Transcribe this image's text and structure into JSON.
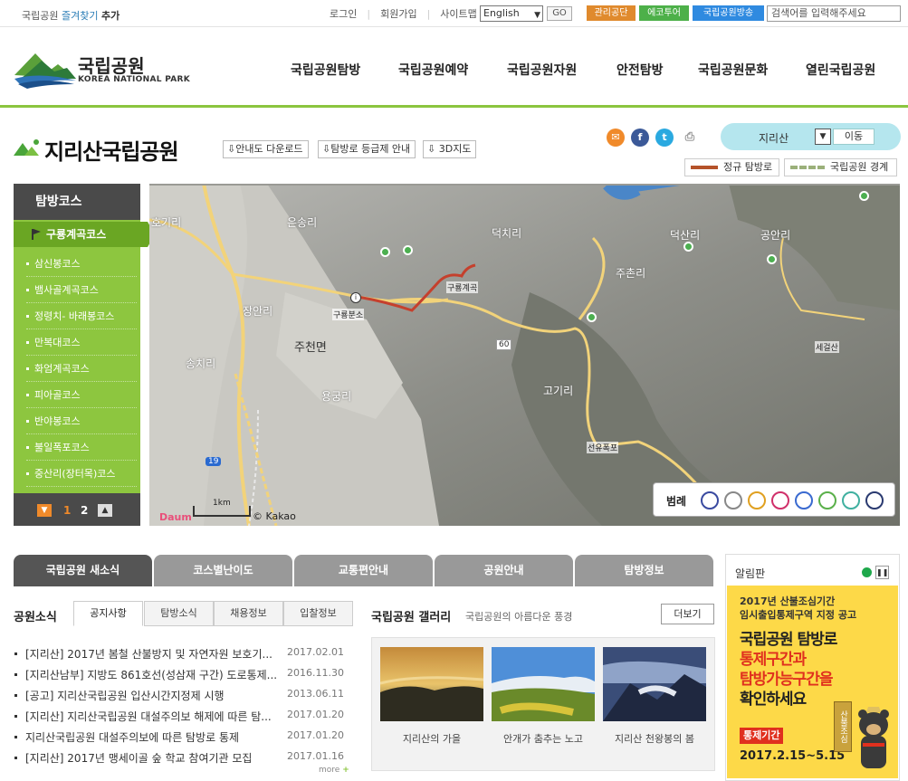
{
  "topbar": {
    "fav_prefix": "국립공원",
    "fav_link": "즐겨찾기",
    "fav_suffix": "추가",
    "links": [
      "로그인",
      "회원가입",
      "사이트맵"
    ],
    "language": "English",
    "go_label": "GO",
    "chips": [
      {
        "label": "관리공단",
        "color": "#e08a2d"
      },
      {
        "label": "에코투어",
        "color": "#4db049"
      },
      {
        "label": "국립공원방송",
        "color": "#2f8ae0"
      }
    ],
    "search_placeholder": "검색어를 입력해주세요"
  },
  "logo": {
    "kr": "국립공원",
    "en": "KOREA NATIONAL PARK"
  },
  "gnb": [
    "국립공원탐방",
    "국립공원예약",
    "국립공원자원",
    "안전탐방",
    "국립공원문화",
    "열린국립공원"
  ],
  "park": {
    "title": "지리산국립공원",
    "buttons": [
      "안내도 다운로드",
      "탐방로 등급제 안내",
      "3D지도"
    ],
    "selected_park": "지리산",
    "move_label": "이동",
    "legend_trail": "정규 탐방로",
    "legend_boundary": "국립공원 경계",
    "colors": {
      "trail": "#b5532a",
      "boundary": "#9bb07a"
    }
  },
  "lnb": {
    "title": "탐방코스",
    "active": "구룡계곡코스",
    "items": [
      "삼신봉코스",
      "뱀사골계곡코스",
      "정령치- 바래봉코스",
      "만복대코스",
      "화엄계곡코스",
      "피아골코스",
      "반야봉코스",
      "불일폭포코스",
      "중산리(장터목)코스"
    ],
    "page_current": "1",
    "page_other": "2"
  },
  "map": {
    "places": [
      "호기리",
      "은송리",
      "덕치리",
      "덕산리",
      "공안리",
      "장안리",
      "주천면",
      "주촌리",
      "세걸산",
      "송치리",
      "용궁리",
      "고기리",
      "선유폭포",
      "구룡분소",
      "구룡계곡"
    ],
    "road_number_1": "60",
    "road_number_2": "19",
    "scale": "1km",
    "copyright": "© Kakao",
    "provider": "Daum",
    "legend_title": "범례",
    "legend_colors": [
      "#3a4aa0",
      "#888888",
      "#e0a020",
      "#d0306a",
      "#3a6ad0",
      "#5ab04a",
      "#40b0a0",
      "#2a3a70"
    ]
  },
  "tabs": [
    "국립공원 새소식",
    "코스별난이도",
    "교통편안내",
    "공원안내",
    "탐방정보"
  ],
  "news": {
    "heading": "공원소식",
    "subtabs": [
      "공지사항",
      "탐방소식",
      "채용정보",
      "입찰정보"
    ],
    "items": [
      {
        "title": "[지리산] 2017년 봄철 산불방지 및 자연자원 보호기...",
        "date": "2017.02.01"
      },
      {
        "title": "[지리산남부] 지방도 861호선(성삼재 구간) 도로통제...",
        "date": "2016.11.30"
      },
      {
        "title": "[공고] 지리산국립공원 입산시간지정제 시행",
        "date": "2013.06.11"
      },
      {
        "title": "[지리산] 지리산국립공원 대설주의보 해제에 따른 탐...",
        "date": "2017.01.20"
      },
      {
        "title": "지리산국립공원 대설주의보에 따른 탐방로 통제",
        "date": "2017.01.20"
      },
      {
        "title": "[지리산] 2017년 맹세이골 숲 학교 참여기관 모집",
        "date": "2017.01.16"
      }
    ],
    "more": "more"
  },
  "gallery": {
    "heading": "국립공원 갤러리",
    "sub": "국립공원의 아름다운 풍경",
    "more_btn": "더보기",
    "captions": [
      "지리산의 가을",
      "안개가 춤추는 노고",
      "지리산 천왕봉의 봄"
    ]
  },
  "notice": {
    "heading": "알림판",
    "line1": "2017년 산불조심기간",
    "line2": "임시출입통제구역 지정 공고",
    "big1": "국립공원 탐방로",
    "big2": "통제구간과",
    "big3": "탐방가능구간을",
    "big4": "확인하세요",
    "control_label": "통제기간",
    "period": "2017.2.15~5.15",
    "sign": "산불조심"
  }
}
